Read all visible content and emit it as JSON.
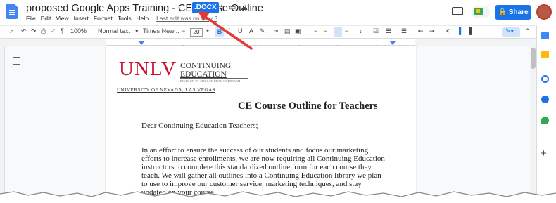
{
  "header": {
    "doc_title": "proposed Google Apps Training - CE Course Outline",
    "file_badge": ".DOCX",
    "menu": [
      "File",
      "Edit",
      "View",
      "Insert",
      "Format",
      "Tools",
      "Help"
    ],
    "last_edit": "Last edit was on May 3",
    "share_label": "Share"
  },
  "toolbar": {
    "zoom": "100%",
    "style": "Normal text",
    "font": "Times New...",
    "font_size": "20",
    "bold": "B",
    "italic": "I",
    "underline": "U",
    "text_color": "A"
  },
  "document": {
    "logo_main": "UNLV",
    "logo_line1": "CONTINUING",
    "logo_line2": "EDUCATION",
    "logo_division": "DIVISION OF EDUCATIONAL OUTREACH",
    "logo_university": "UNIVERSITY OF NEVADA, LAS VEGAS",
    "heading": "CE Course Outline for Teachers",
    "greeting": "Dear Continuing Education Teachers;",
    "paragraph": "In an effort to ensure the success of our students and focus our marketing efforts to increase enrollments, we are now requiring all Continuing Education instructors to complete this standardized outline form for each course they teach. We will gather all outlines into a Continuing Education library we plan to use to improve our customer service, marketing techniques, and stay updated on your course."
  },
  "colors": {
    "accent": "#1a73e8",
    "unlv_red": "#c8102e",
    "annotation_arrow": "#e53935"
  }
}
